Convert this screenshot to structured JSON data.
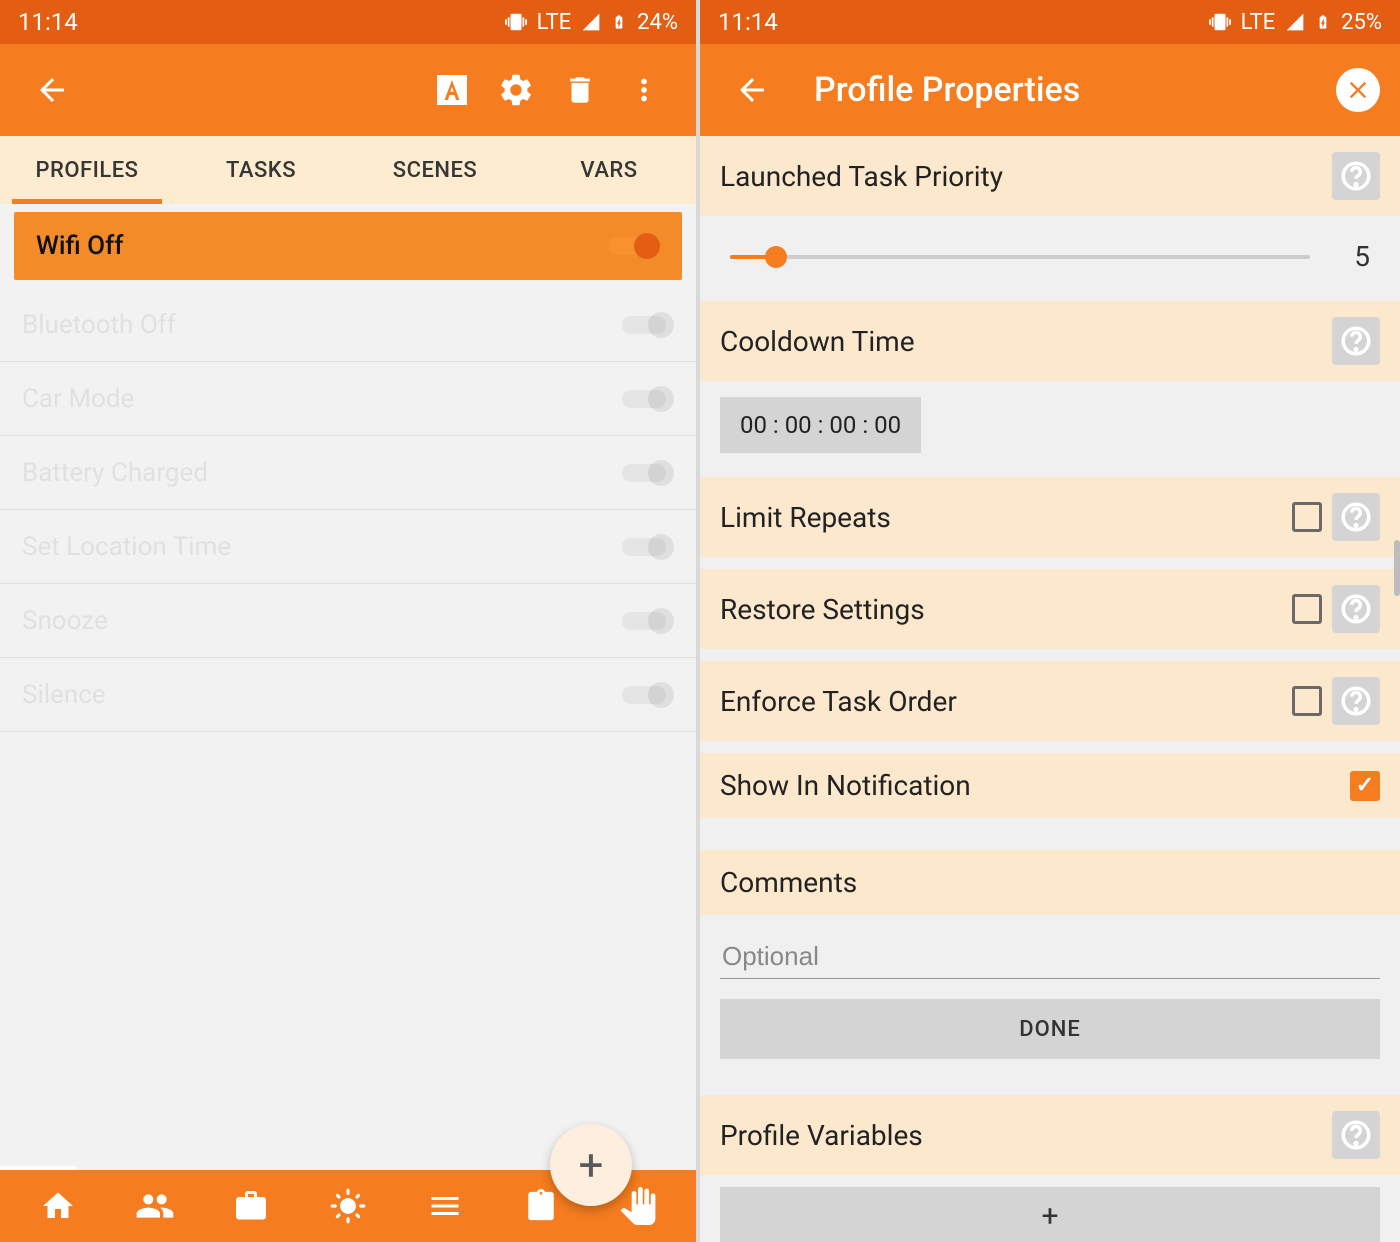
{
  "left": {
    "status": {
      "time": "11:14",
      "network": "LTE",
      "battery": "24%"
    },
    "tabs": [
      "PROFILES",
      "TASKS",
      "SCENES",
      "VARS"
    ],
    "active_tab": 0,
    "profiles": [
      {
        "name": "Wifi Off",
        "selected": true
      },
      {
        "name": "Bluetooth Off",
        "faded": true
      },
      {
        "name": "Car Mode",
        "faded": true
      },
      {
        "name": "Battery Charged",
        "faded": true
      },
      {
        "name": "Set Location Time",
        "faded": true
      },
      {
        "name": "Snooze",
        "faded": true
      },
      {
        "name": "Silence",
        "faded": true
      }
    ]
  },
  "right": {
    "status": {
      "time": "11:14",
      "network": "LTE",
      "battery": "25%"
    },
    "title": "Profile Properties",
    "sections": {
      "launched_priority": {
        "label": "Launched Task Priority",
        "value": "5"
      },
      "cooldown": {
        "label": "Cooldown Time",
        "value": "00 : 00 : 00 : 00"
      },
      "limit_repeats": {
        "label": "Limit Repeats",
        "checked": false
      },
      "restore_settings": {
        "label": "Restore Settings",
        "checked": false
      },
      "enforce_order": {
        "label": "Enforce Task Order",
        "checked": false
      },
      "show_notification": {
        "label": "Show In Notification",
        "checked": true
      },
      "comments": {
        "label": "Comments",
        "placeholder": "Optional"
      },
      "done": "DONE",
      "variables": {
        "label": "Profile Variables",
        "add": "+"
      }
    }
  }
}
